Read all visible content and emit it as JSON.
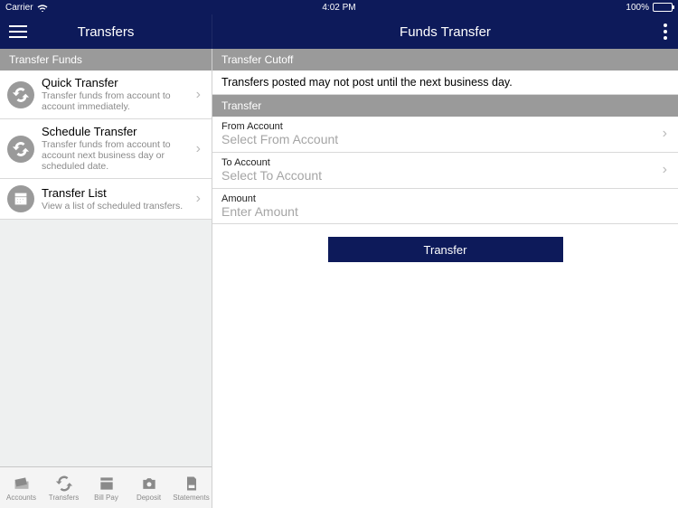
{
  "status": {
    "carrier": "Carrier",
    "time": "4:02 PM",
    "battery": "100%"
  },
  "nav": {
    "left_title": "Transfers",
    "right_title": "Funds Transfer"
  },
  "sidebar": {
    "header": "Transfer Funds",
    "items": [
      {
        "title": "Quick Transfer",
        "desc": "Transfer funds from account to account immediately."
      },
      {
        "title": "Schedule Transfer",
        "desc": "Transfer funds from account to account next business day or scheduled date."
      },
      {
        "title": "Transfer List",
        "desc": "View a list of scheduled transfers."
      }
    ]
  },
  "main": {
    "cutoff_header": "Transfer Cutoff",
    "cutoff_msg": "Transfers posted may not post until the next business day.",
    "transfer_header": "Transfer",
    "from_label": "From Account",
    "from_placeholder": "Select From Account",
    "to_label": "To Account",
    "to_placeholder": "Select To Account",
    "amount_label": "Amount",
    "amount_placeholder": "Enter Amount",
    "button": "Transfer"
  },
  "tabs": {
    "accounts": "Accounts",
    "transfers": "Transfers",
    "billpay": "Bill Pay",
    "deposit": "Deposit",
    "statements": "Statements"
  }
}
